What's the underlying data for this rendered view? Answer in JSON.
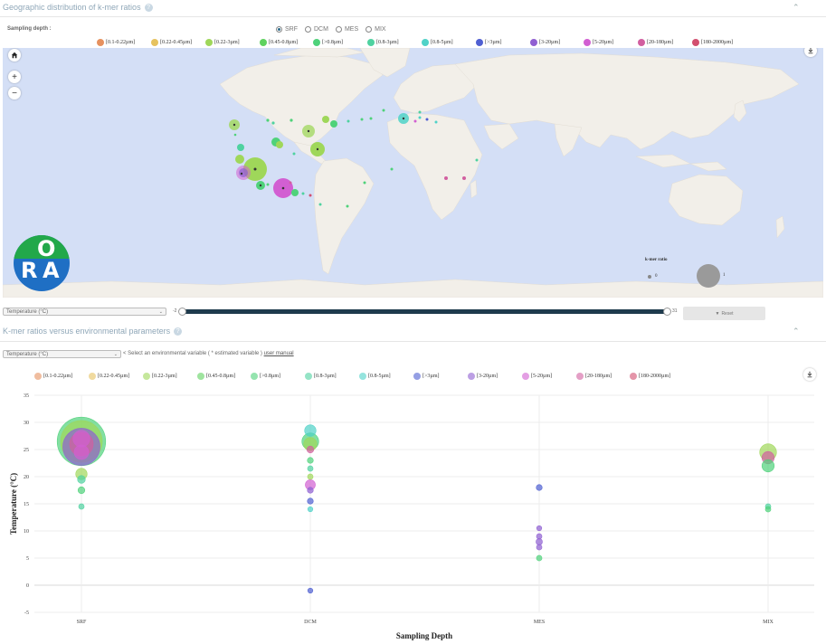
{
  "map_panel": {
    "title": "Geographic distribution of k-mer ratios",
    "help": "?",
    "collapse": "⌃",
    "sampling_label": "Sampling depth :",
    "depth_options": [
      {
        "label": "SRF",
        "selected": true
      },
      {
        "label": "DCM",
        "selected": false
      },
      {
        "label": "MES",
        "selected": false
      },
      {
        "label": "MIX",
        "selected": false
      }
    ],
    "legend": [
      {
        "label": "[0.1-0.22µm]",
        "color": "#e6915f"
      },
      {
        "label": "[0.22-0.45µm]",
        "color": "#e6c25f"
      },
      {
        "label": "[0.22-3µm]",
        "color": "#9fd75a"
      },
      {
        "label": "[0.45-0.8µm]",
        "color": "#5fd25f"
      },
      {
        "label": "[>0.8µm]",
        "color": "#4fd27a"
      },
      {
        "label": "[0.8-3µm]",
        "color": "#4fd2a0"
      },
      {
        "label": "[0.8-5µm]",
        "color": "#4fd2c8"
      },
      {
        "label": "[>3µm]",
        "color": "#4f5fd2"
      },
      {
        "label": "[3-20µm]",
        "color": "#8f5fd2"
      },
      {
        "label": "[5-20µm]",
        "color": "#d25fd2"
      },
      {
        "label": "[20-180µm]",
        "color": "#d25fa0"
      },
      {
        "label": "[180-2000µm]",
        "color": "#d24f6f"
      }
    ],
    "zoom_in": "+",
    "zoom_out": "−",
    "home_icon": "home-icon",
    "download_icon": "download-icon",
    "logo_letters": [
      "O",
      "R",
      "A"
    ],
    "size_legend_title": "k-mer ratio",
    "size_legend_small": "0",
    "size_legend_large": "1",
    "variable_select": "Temperature (°C)",
    "slider_min": "-2",
    "slider_max": "31",
    "reset_label": "Reset"
  },
  "scatter_panel": {
    "title": "K-mer ratios versus environmental parameters",
    "help": "?",
    "collapse": "⌃",
    "variable_select": "Temperature (°C)",
    "hint": "< Select an environmental variable ( * estimated variable )",
    "manual_link": "user manual",
    "legend": [
      {
        "label": "[0.1-0.22µm]",
        "color": "#e6915f"
      },
      {
        "label": "[0.22-0.45µm]",
        "color": "#e6c25f"
      },
      {
        "label": "[0.22-3µm]",
        "color": "#9fd75a"
      },
      {
        "label": "[0.45-0.8µm]",
        "color": "#5fd25f"
      },
      {
        "label": "[>0.8µm]",
        "color": "#4fd27a"
      },
      {
        "label": "[0.8-3µm]",
        "color": "#4fd2a0"
      },
      {
        "label": "[0.8-5µm]",
        "color": "#4fd2c8"
      },
      {
        "label": "[>3µm]",
        "color": "#4f5fd2"
      },
      {
        "label": "[3-20µm]",
        "color": "#8f5fd2"
      },
      {
        "label": "[5-20µm]",
        "color": "#d25fd2"
      },
      {
        "label": "[20-180µm]",
        "color": "#d25fa0"
      },
      {
        "label": "[180-2000µm]",
        "color": "#d24f6f"
      }
    ],
    "download_icon": "download-icon"
  },
  "chart_data": {
    "type": "scatter",
    "xlabel": "Sampling Depth",
    "ylabel": "Temperature (°C)",
    "categories": [
      "SRF",
      "DCM",
      "MES",
      "MIX"
    ],
    "ylim": [
      -5,
      35
    ],
    "yticks": [
      -5,
      0,
      5,
      10,
      15,
      20,
      25,
      30,
      35
    ],
    "grid": true,
    "points": [
      {
        "x": "SRF",
        "y": 26.5,
        "ratio": 1.0,
        "color": "#4fd27a"
      },
      {
        "x": "SRF",
        "y": 26.5,
        "ratio": 0.85,
        "color": "#9fd75a"
      },
      {
        "x": "SRF",
        "y": 25.5,
        "ratio": 0.75,
        "color": "#8f5fd2"
      },
      {
        "x": "SRF",
        "y": 26.0,
        "ratio": 0.45,
        "color": "#d25fa0"
      },
      {
        "x": "SRF",
        "y": 27.0,
        "ratio": 0.3,
        "color": "#d25fd2"
      },
      {
        "x": "SRF",
        "y": 24.5,
        "ratio": 0.25,
        "color": "#d25fd2"
      },
      {
        "x": "SRF",
        "y": 20.5,
        "ratio": 0.18,
        "color": "#9fd75a"
      },
      {
        "x": "SRF",
        "y": 19.5,
        "ratio": 0.1,
        "color": "#4fd2a0"
      },
      {
        "x": "SRF",
        "y": 17.5,
        "ratio": 0.08,
        "color": "#4fd27a"
      },
      {
        "x": "SRF",
        "y": 14.5,
        "ratio": 0.05,
        "color": "#4fd2a0"
      },
      {
        "x": "DCM",
        "y": 28.5,
        "ratio": 0.18,
        "color": "#4fd2c8"
      },
      {
        "x": "DCM",
        "y": 26.5,
        "ratio": 0.3,
        "color": "#4fd27a"
      },
      {
        "x": "DCM",
        "y": 26.0,
        "ratio": 0.22,
        "color": "#9fd75a"
      },
      {
        "x": "DCM",
        "y": 25.0,
        "ratio": 0.08,
        "color": "#d25fa0"
      },
      {
        "x": "DCM",
        "y": 23.0,
        "ratio": 0.06,
        "color": "#4fd27a"
      },
      {
        "x": "DCM",
        "y": 21.5,
        "ratio": 0.05,
        "color": "#4fd2a0"
      },
      {
        "x": "DCM",
        "y": 20.0,
        "ratio": 0.05,
        "color": "#9fd75a"
      },
      {
        "x": "DCM",
        "y": 18.5,
        "ratio": 0.15,
        "color": "#d25fd2"
      },
      {
        "x": "DCM",
        "y": 17.5,
        "ratio": 0.06,
        "color": "#8f5fd2"
      },
      {
        "x": "DCM",
        "y": 15.5,
        "ratio": 0.06,
        "color": "#4f5fd2"
      },
      {
        "x": "DCM",
        "y": 14.0,
        "ratio": 0.04,
        "color": "#4fd2c8"
      },
      {
        "x": "DCM",
        "y": -1.0,
        "ratio": 0.04,
        "color": "#4f5fd2"
      },
      {
        "x": "MES",
        "y": 18.0,
        "ratio": 0.06,
        "color": "#4f5fd2"
      },
      {
        "x": "MES",
        "y": 10.5,
        "ratio": 0.04,
        "color": "#8f5fd2"
      },
      {
        "x": "MES",
        "y": 9.0,
        "ratio": 0.05,
        "color": "#8f5fd2"
      },
      {
        "x": "MES",
        "y": 8.0,
        "ratio": 0.07,
        "color": "#8f5fd2"
      },
      {
        "x": "MES",
        "y": 7.0,
        "ratio": 0.05,
        "color": "#8f5fd2"
      },
      {
        "x": "MES",
        "y": 5.0,
        "ratio": 0.05,
        "color": "#4fd27a"
      },
      {
        "x": "MIX",
        "y": 24.5,
        "ratio": 0.3,
        "color": "#9fd75a"
      },
      {
        "x": "MIX",
        "y": 23.5,
        "ratio": 0.2,
        "color": "#d25fa0"
      },
      {
        "x": "MIX",
        "y": 22.0,
        "ratio": 0.2,
        "color": "#4fd27a"
      },
      {
        "x": "MIX",
        "y": 14.5,
        "ratio": 0.05,
        "color": "#4fd2a0"
      },
      {
        "x": "MIX",
        "y": 14.0,
        "ratio": 0.05,
        "color": "#4fd27a"
      }
    ]
  }
}
